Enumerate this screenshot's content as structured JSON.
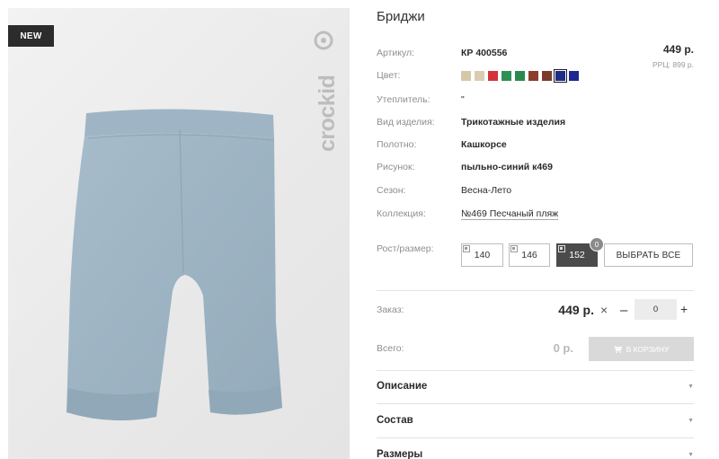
{
  "product": {
    "title": "Бриджи",
    "badge": "NEW",
    "brand_logo_text": "crockid",
    "price": "449 р.",
    "rrp": "РРЦ: 899 р."
  },
  "attributes": {
    "article_label": "Артикул:",
    "article_value": "КР 400556",
    "color_label": "Цвет:",
    "insulation_label": "Утеплитель:",
    "insulation_value": "\"",
    "type_label": "Вид изделия:",
    "type_value": "Трикотажные изделия",
    "fabric_label": "Полотно:",
    "fabric_value": "Кашкорсе",
    "pattern_label": "Рисунок:",
    "pattern_value": "пыльно-синий к469",
    "season_label": "Сезон:",
    "season_value": "Весна-Лето",
    "collection_label": "Коллекция:",
    "collection_value": "№469 Песчаный пляж"
  },
  "swatches": [
    {
      "color": "#d6c7a9",
      "selected": false
    },
    {
      "color": "#d9ccb1",
      "selected": false
    },
    {
      "color": "#d3343a",
      "selected": false
    },
    {
      "color": "#2f8f55",
      "selected": false
    },
    {
      "color": "#2a8a4e",
      "selected": false
    },
    {
      "color": "#8a3e2e",
      "selected": false
    },
    {
      "color": "#7a3a2c",
      "selected": false
    },
    {
      "color": "#1c2c88",
      "selected": true
    },
    {
      "color": "#1d2990",
      "selected": false
    }
  ],
  "sizes": {
    "label": "Рост/размер:",
    "options": [
      "140",
      "146",
      "152"
    ],
    "active": "152",
    "count_badge": "0",
    "select_all": "ВЫБРАТЬ ВСЕ"
  },
  "order": {
    "label": "Заказ:",
    "price": "449 р.",
    "times": "×",
    "minus": "–",
    "quantity": "0",
    "plus": "+",
    "total_label": "Всего:",
    "total_value": "0 р.",
    "cart_button": "В КОРЗИНУ"
  },
  "accordion": [
    {
      "title": "Описание"
    },
    {
      "title": "Состав"
    },
    {
      "title": "Размеры"
    }
  ],
  "icons": {
    "arrow": "▼",
    "cart": "cart-icon",
    "size": "size-checkbox-icon"
  },
  "colors": {
    "pants": "#9db4c4",
    "active_size": "#4b4b4b",
    "disabled_button": "#d9d9d9"
  }
}
